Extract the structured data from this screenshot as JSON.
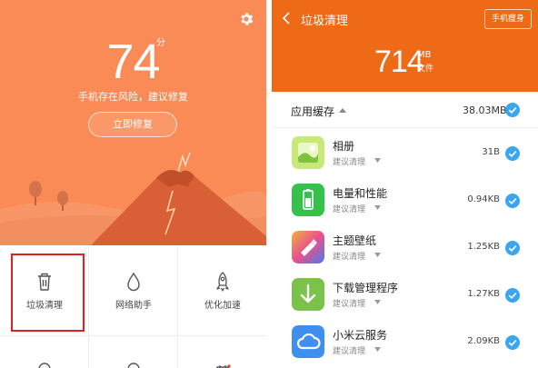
{
  "left": {
    "score": "74",
    "score_unit": "分",
    "status": "手机存在风险，建议修复",
    "fix_button": "立即修复",
    "grid": [
      {
        "label": "垃圾清理",
        "icon": "trash-icon"
      },
      {
        "label": "网络助手",
        "icon": "drop-icon"
      },
      {
        "label": "优化加速",
        "icon": "rocket-icon"
      },
      {
        "label": "",
        "icon": "shield-icon"
      },
      {
        "label": "",
        "icon": "clock-icon"
      },
      {
        "label": "",
        "icon": "calendar-icon"
      }
    ]
  },
  "right": {
    "title": "垃圾清理",
    "slim_button": "手机瘦身",
    "total_size": "714",
    "total_unit": "MB",
    "total_label": "文件",
    "cache_title": "应用缓存",
    "cache_total": "38.03MB",
    "suggestion": "建议清理",
    "apps": [
      {
        "name": "相册",
        "size": "31B",
        "icon": "gallery-icon"
      },
      {
        "name": "电量和性能",
        "size": "0.94KB",
        "icon": "battery-icon"
      },
      {
        "name": "主题壁纸",
        "size": "1.25KB",
        "icon": "theme-brush-icon"
      },
      {
        "name": "下载管理程序",
        "size": "1.27KB",
        "icon": "download-icon"
      },
      {
        "name": "小米云服务",
        "size": "2.09KB",
        "icon": "cloud-icon"
      }
    ]
  },
  "colors": {
    "left_header": "#fa8a56",
    "right_header": "#ef6a17",
    "check": "#3aa6ef",
    "highlight": "#e02020"
  }
}
